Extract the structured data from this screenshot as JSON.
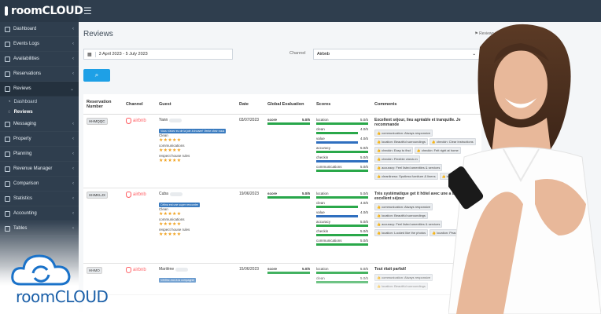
{
  "brand": {
    "name": "roomCLOUD",
    "hero_name": "roomCLOUD"
  },
  "sidebar": {
    "items": [
      {
        "label": "Dashboard",
        "icon": "gauge-icon"
      },
      {
        "label": "Events Logs",
        "icon": "list-icon"
      },
      {
        "label": "Availabilities",
        "icon": "calendar-icon"
      },
      {
        "label": "Reservations",
        "icon": "book-icon"
      },
      {
        "label": "Reviews",
        "icon": "star-icon",
        "active": true
      },
      {
        "label": "Messaging",
        "icon": "chat-icon"
      },
      {
        "label": "Property",
        "icon": "building-icon"
      },
      {
        "label": "Planning",
        "icon": "planning-icon"
      },
      {
        "label": "Revenue Manager",
        "icon": "chart-icon"
      },
      {
        "label": "Comparison",
        "icon": "compare-icon"
      },
      {
        "label": "Statistics",
        "icon": "stats-icon"
      },
      {
        "label": "Accounting",
        "icon": "accounting-icon"
      },
      {
        "label": "Tables",
        "icon": "table-icon"
      }
    ],
    "sub_items": [
      {
        "label": "Dashboard"
      },
      {
        "label": "Reviews",
        "active": true
      }
    ]
  },
  "page": {
    "title": "Reviews",
    "breadcrumb": "Reviews"
  },
  "filters": {
    "date_range": "3 April 2023 - 5 July 2023",
    "channel_label": "Channel",
    "channel_value": "Airbnb"
  },
  "table": {
    "headers": [
      "Reservation Number",
      "Channel",
      "Guest",
      "Date",
      "Global Evaluation",
      "Scores",
      "Comments"
    ],
    "rows": [
      {
        "res": "HHMQQC",
        "channel": "airbnb",
        "guest": "Yann",
        "guest_tag": "Vous n'avez eu de la joie à trouver! Vente chez nous",
        "categories": [
          "Clean",
          "communications",
          "respect house rules"
        ],
        "date": "03/07/2023",
        "global_label": "score",
        "global_value": "5.0",
        "global_max": "/5",
        "scores": [
          {
            "label": "location",
            "value": "5.0",
            "max": "/5",
            "color": "green"
          },
          {
            "label": "clean",
            "value": "4.0",
            "max": "/5",
            "color": "green"
          },
          {
            "label": "value",
            "value": "4.0",
            "max": "/5",
            "color": "blue"
          },
          {
            "label": "accuracy",
            "value": "5.0",
            "max": "/5",
            "color": "green"
          },
          {
            "label": "checkin",
            "value": "5.0",
            "max": "/5",
            "color": "blue"
          },
          {
            "label": "communications",
            "value": "5.0",
            "max": "/5",
            "color": "green"
          }
        ],
        "comment_title": "Excellent séjour, lieu agréable et tranquille. Je recommande",
        "tags": [
          "communication: Always responsive",
          "location: Beautiful surroundings",
          "checkin: Clear instructions",
          "checkin: Easy to find",
          "checkin: Felt right at home",
          "checkin: Flexible check-in",
          "accuracy: Feel listed amenities & services",
          "cleanliness: Spotless furniture & linens",
          "location: Walkable"
        ]
      },
      {
        "res": "HHMKLJX",
        "channel": "airbnb",
        "guest": "Cuba",
        "guest_tag": "Célina est une super rencontre",
        "categories": [
          "Clean",
          "communications",
          "respect house rules"
        ],
        "date": "19/06/2023",
        "global_label": "score",
        "global_value": "5.0",
        "global_max": "/5",
        "scores": [
          {
            "label": "location",
            "value": "5.0",
            "max": "/5",
            "color": "green"
          },
          {
            "label": "clean",
            "value": "4.0",
            "max": "/5",
            "color": "green"
          },
          {
            "label": "value",
            "value": "4.0",
            "max": "/5",
            "color": "blue"
          },
          {
            "label": "accuracy",
            "value": "5.0",
            "max": "/5",
            "color": "green"
          },
          {
            "label": "checkin",
            "value": "5.0",
            "max": "/5",
            "color": "green"
          },
          {
            "label": "communications",
            "value": "5.0",
            "max": "/5",
            "color": "green"
          }
        ],
        "comment_title": "Très systématique get it hôtel avec une a chaleureuse excellent séjour",
        "tags": [
          "communication: Always responsive",
          "location: Beautiful surroundings",
          "accuracy: Feel listed amenities & services",
          "location: Looked like the photos",
          "location: Peaceful"
        ]
      },
      {
        "res": "HHMO",
        "channel": "airbnb",
        "guest": "Marilène",
        "guest_tag": "Vérifiez-moi à la compagnie",
        "categories": [],
        "date": "15/06/2023",
        "global_label": "score",
        "global_value": "5.0",
        "global_max": "/5",
        "scores": [
          {
            "label": "location",
            "value": "5.0",
            "max": "/5",
            "color": "green"
          },
          {
            "label": "clean",
            "value": "5.0",
            "max": "/5",
            "color": "green"
          }
        ],
        "comment_title": "Tout était parfait!",
        "tags": [
          "communication: Always responsive",
          "location: Beautiful surroundings"
        ]
      }
    ]
  }
}
